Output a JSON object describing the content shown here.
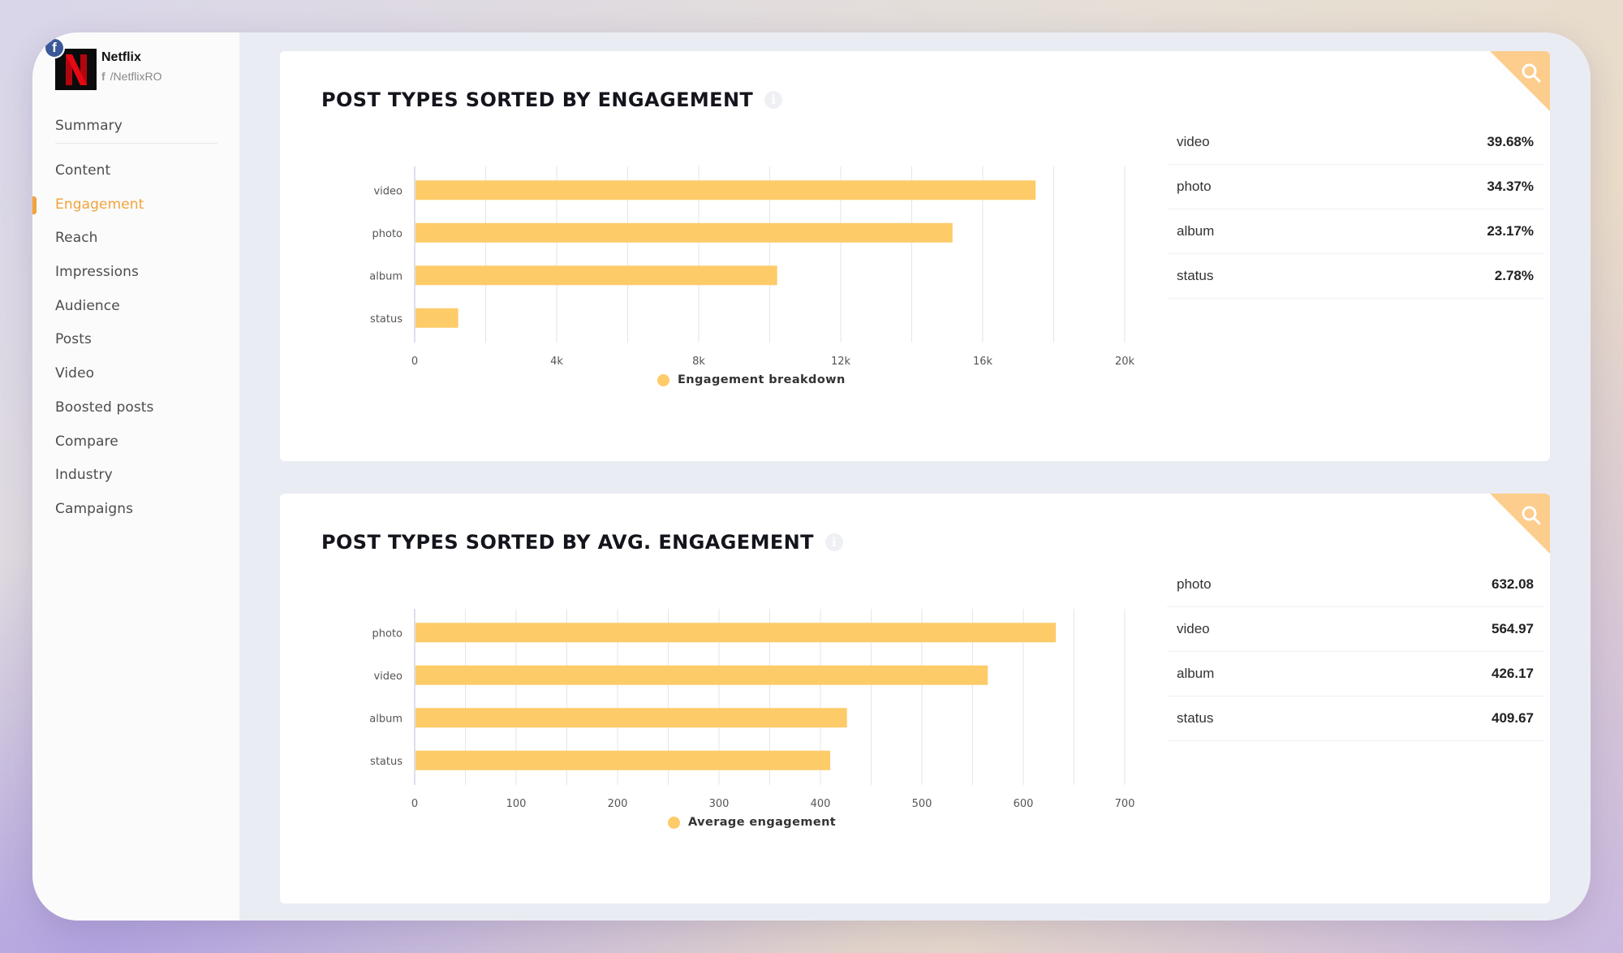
{
  "profile": {
    "name": "Netflix",
    "handle": "/NetflixRO",
    "network_badge": "f",
    "logo_letter": "N"
  },
  "sidebar": {
    "items": [
      {
        "label": "Summary",
        "active": false
      },
      {
        "label": "Content",
        "active": false
      },
      {
        "label": "Engagement",
        "active": true
      },
      {
        "label": "Reach",
        "active": false
      },
      {
        "label": "Impressions",
        "active": false
      },
      {
        "label": "Audience",
        "active": false
      },
      {
        "label": "Posts",
        "active": false
      },
      {
        "label": "Video",
        "active": false
      },
      {
        "label": "Boosted posts",
        "active": false
      },
      {
        "label": "Compare",
        "active": false
      },
      {
        "label": "Industry",
        "active": false
      },
      {
        "label": "Campaigns",
        "active": false
      }
    ]
  },
  "colors": {
    "accent": "#f2a33a",
    "bar": "#fecb69",
    "corner": "#fdcd8d",
    "facebook": "#3b5998",
    "netflix_red": "#e50914"
  },
  "cards": [
    {
      "title": "POST TYPES SORTED BY ENGAGEMENT",
      "info_icon": "i",
      "table": [
        {
          "label": "video",
          "value": "39.68%"
        },
        {
          "label": "photo",
          "value": "34.37%"
        },
        {
          "label": "album",
          "value": "23.17%"
        },
        {
          "label": "status",
          "value": "2.78%"
        }
      ]
    },
    {
      "title": "POST TYPES SORTED BY AVG. ENGAGEMENT",
      "info_icon": "i",
      "table": [
        {
          "label": "photo",
          "value": "632.08"
        },
        {
          "label": "video",
          "value": "564.97"
        },
        {
          "label": "album",
          "value": "426.17"
        },
        {
          "label": "status",
          "value": "409.67"
        }
      ]
    }
  ],
  "chart_data": [
    {
      "type": "bar",
      "orientation": "horizontal",
      "title": "POST TYPES SORTED BY ENGAGEMENT",
      "categories": [
        "video",
        "photo",
        "album",
        "status"
      ],
      "series": [
        {
          "name": "Engagement breakdown",
          "values": [
            17490,
            15150,
            10210,
            1225
          ]
        }
      ],
      "xlim": [
        0,
        20000
      ],
      "xticks": [
        0,
        4000,
        8000,
        12000,
        16000,
        20000
      ],
      "xtick_labels": [
        "0",
        "4k",
        "8k",
        "12k",
        "16k",
        "20k"
      ],
      "grid_step": 2000,
      "grid": true,
      "legend": "bottom-center"
    },
    {
      "type": "bar",
      "orientation": "horizontal",
      "title": "POST TYPES SORTED BY AVG. ENGAGEMENT",
      "categories": [
        "photo",
        "video",
        "album",
        "status"
      ],
      "series": [
        {
          "name": "Average engagement",
          "values": [
            632.08,
            564.97,
            426.17,
            409.67
          ]
        }
      ],
      "xlim": [
        0,
        700
      ],
      "xticks": [
        0,
        100,
        200,
        300,
        400,
        500,
        600,
        700
      ],
      "xtick_labels": [
        "0",
        "100",
        "200",
        "300",
        "400",
        "500",
        "600",
        "700"
      ],
      "grid_step": 50,
      "grid": true,
      "legend": "bottom-center"
    }
  ]
}
